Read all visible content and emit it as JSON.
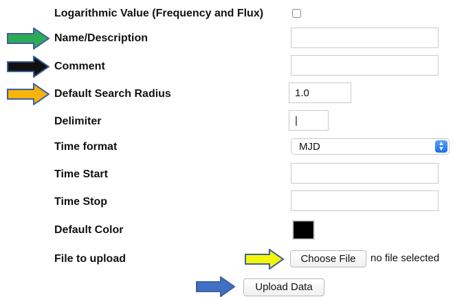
{
  "fields": {
    "log_value_label": "Logarithmic Value (Frequency and Flux)",
    "name_label": "Name/Description",
    "name_value": "",
    "comment_label": "Comment",
    "comment_value": "",
    "radius_label": "Default Search Radius",
    "radius_value": "1.0",
    "delimiter_label": "Delimiter",
    "delimiter_value": "|",
    "time_format_label": "Time format",
    "time_format_value": "MJD",
    "time_start_label": "Time Start",
    "time_start_value": "",
    "time_stop_label": "Time Stop",
    "time_stop_value": "",
    "color_label": "Default Color",
    "color_value": "#000000",
    "file_label": "File to upload",
    "choose_file_label": "Choose File",
    "no_file_text": "no file selected"
  },
  "upload_button_label": "Upload Data",
  "arrows": {
    "name": "#2eaa57",
    "comment": "#111111",
    "radius": "#f6b30a",
    "file": "#f5f50a",
    "upload": "#3f70c6",
    "outline": "#3f5f9a"
  },
  "icons": [
    "checkbox",
    "select-stepper-icon",
    "arrow-icon"
  ]
}
